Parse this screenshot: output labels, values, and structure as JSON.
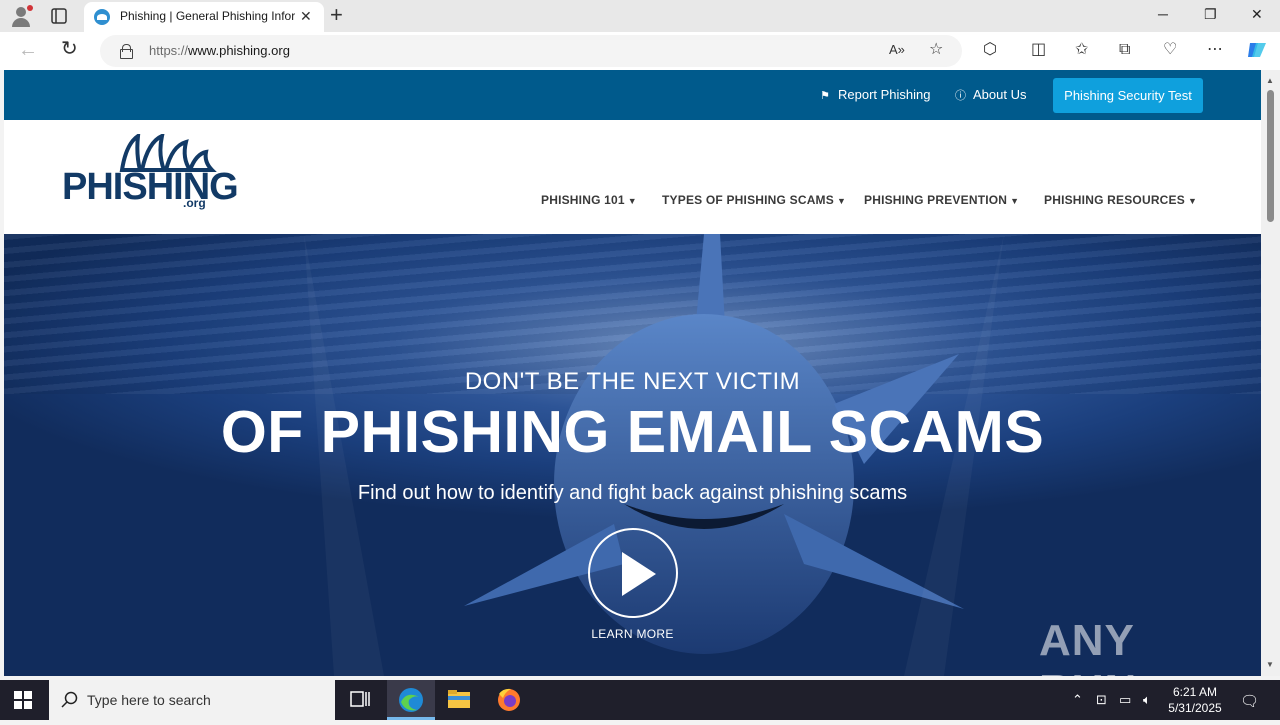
{
  "browser": {
    "tab_title": "Phishing | General Phishing Information",
    "url_scheme": "https://",
    "url_host": "www.phishing.org",
    "new_tab_symbol": "+",
    "tab_close_symbol": "✕"
  },
  "site": {
    "top_links": [
      {
        "label": "Report Phishing",
        "icon": "flag-icon"
      },
      {
        "label": "About Us",
        "icon": "info-icon"
      }
    ],
    "test_button": "Phishing Security Test",
    "logo_word": "PHISHING",
    "logo_tld": ".org",
    "nav": [
      {
        "label": "PHISHING 101"
      },
      {
        "label": "TYPES OF PHISHING SCAMS"
      },
      {
        "label": "PHISHING PREVENTION"
      },
      {
        "label": "PHISHING RESOURCES"
      }
    ],
    "hero": {
      "subheading": "DON'T BE THE NEXT VICTIM",
      "heading": "OF PHISHING EMAIL SCAMS",
      "description": "Find out how to identify and fight back against phishing scams",
      "cta": "LEARN MORE"
    },
    "watermark": "ANY RUN"
  },
  "taskbar": {
    "search_placeholder": "Type here to search",
    "time": "6:21 AM",
    "date": "5/31/2025"
  },
  "colors": {
    "topbar": "#005a8c",
    "test_button": "#0fa0dd",
    "logo": "#123a66",
    "hero_deep": "#112c5c"
  }
}
